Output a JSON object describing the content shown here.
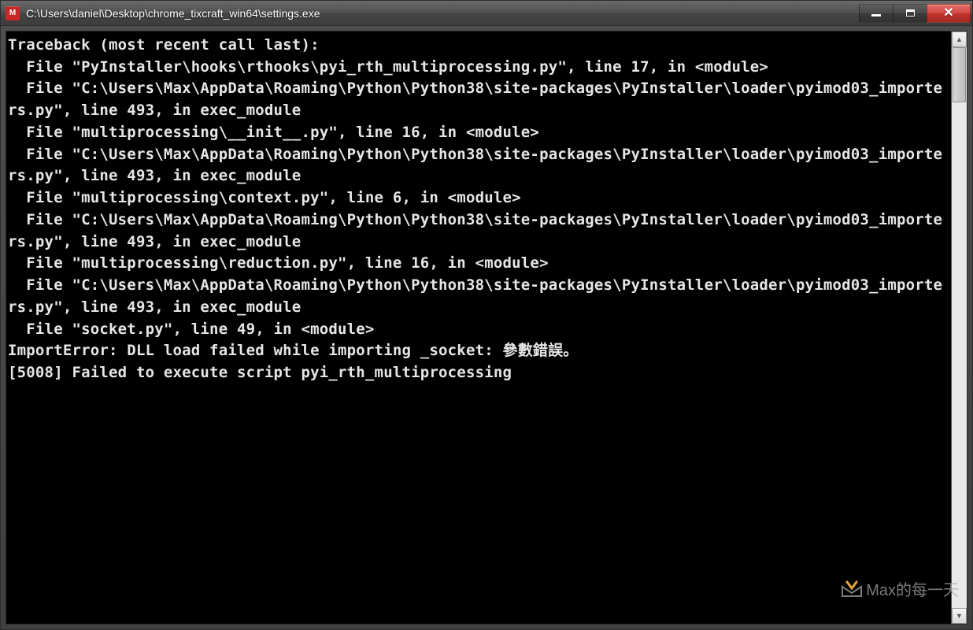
{
  "window": {
    "title": "C:\\Users\\daniel\\Desktop\\chrome_tixcraft_win64\\settings.exe",
    "app_icon_label": "M"
  },
  "console": {
    "lines": [
      "Traceback (most recent call last):",
      "  File \"PyInstaller\\hooks\\rthooks\\pyi_rth_multiprocessing.py\", line 17, in <module>",
      "  File \"C:\\Users\\Max\\AppData\\Roaming\\Python\\Python38\\site-packages\\PyInstaller\\loader\\pyimod03_importers.py\", line 493, in exec_module",
      "  File \"multiprocessing\\__init__.py\", line 16, in <module>",
      "  File \"C:\\Users\\Max\\AppData\\Roaming\\Python\\Python38\\site-packages\\PyInstaller\\loader\\pyimod03_importers.py\", line 493, in exec_module",
      "  File \"multiprocessing\\context.py\", line 6, in <module>",
      "  File \"C:\\Users\\Max\\AppData\\Roaming\\Python\\Python38\\site-packages\\PyInstaller\\loader\\pyimod03_importers.py\", line 493, in exec_module",
      "  File \"multiprocessing\\reduction.py\", line 16, in <module>",
      "  File \"C:\\Users\\Max\\AppData\\Roaming\\Python\\Python38\\site-packages\\PyInstaller\\loader\\pyimod03_importers.py\", line 493, in exec_module",
      "  File \"socket.py\", line 49, in <module>",
      "ImportError: DLL load failed while importing _socket: 參數錯誤。",
      "[5008] Failed to execute script pyi_rth_multiprocessing"
    ]
  },
  "watermark": {
    "text": "Max的每一天"
  }
}
